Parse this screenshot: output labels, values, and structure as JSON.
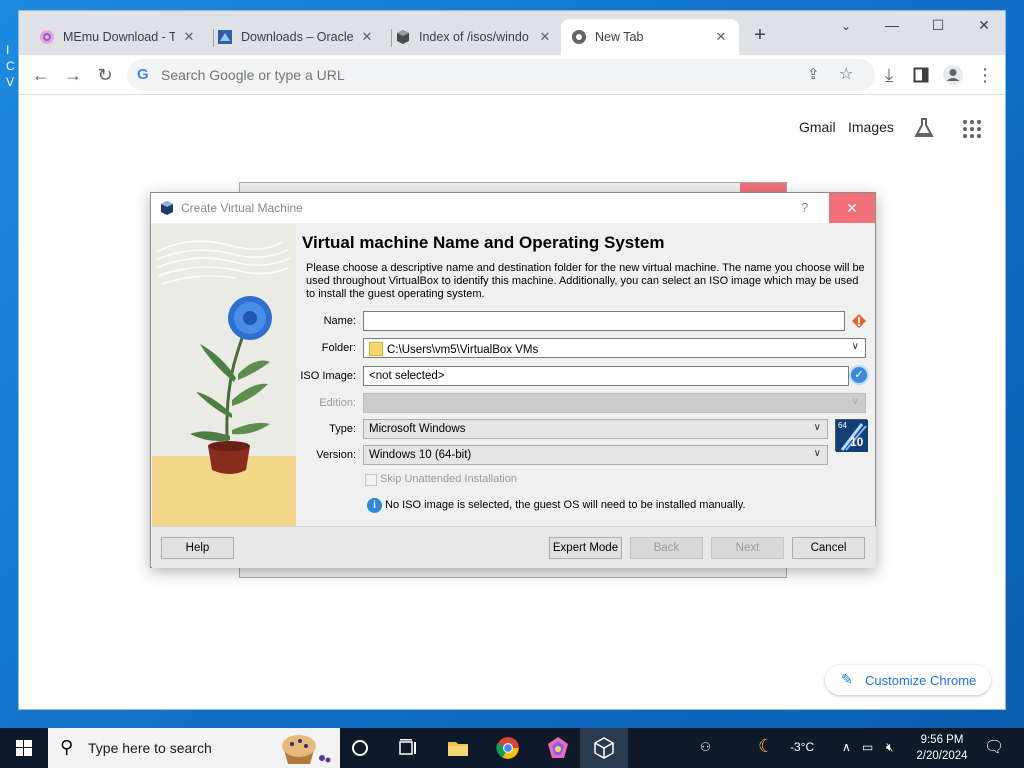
{
  "desktop": {
    "side_text": "I C V"
  },
  "browser": {
    "tabs": [
      {
        "title": "MEmu Download - Th",
        "active": false
      },
      {
        "title": "Downloads – Oracle V",
        "active": false
      },
      {
        "title": "Index of /isos/windo",
        "active": false
      },
      {
        "title": "New Tab",
        "active": true
      }
    ],
    "omnibox_placeholder": "Search Google or type a URL",
    "gbar": {
      "gmail": "Gmail",
      "images": "Images"
    },
    "customize_label": "Customize Chrome"
  },
  "dialog": {
    "window_title": "Create Virtual Machine",
    "help_glyph": "?",
    "heading": "Virtual machine Name and Operating System",
    "description": "Please choose a descriptive name and destination folder for the new virtual machine. The name you choose will be used throughout VirtualBox to identify this machine. Additionally, you can select an ISO image which may be used to install the guest operating system.",
    "labels": {
      "name": "Name:",
      "folder": "Folder:",
      "iso": "ISO Image:",
      "edition": "Edition:",
      "type": "Type:",
      "version": "Version:"
    },
    "values": {
      "name": "",
      "folder": "C:\\Users\\vm5\\VirtualBox VMs",
      "iso": "<not selected>",
      "edition": "",
      "type": "Microsoft Windows",
      "version": "Windows 10 (64-bit)"
    },
    "os_badge": {
      "top": "64",
      "bottom": "10"
    },
    "skip_unattended": "Skip Unattended Installation",
    "info_text": "No ISO image is selected, the guest OS will need to be installed manually.",
    "buttons": {
      "help": "Help",
      "expert": "Expert Mode",
      "back": "Back",
      "next": "Next",
      "cancel": "Cancel"
    }
  },
  "taskbar": {
    "search_placeholder": "Type here to search",
    "temperature": "-3°C",
    "time": "9:56 PM",
    "date": "2/20/2024"
  }
}
